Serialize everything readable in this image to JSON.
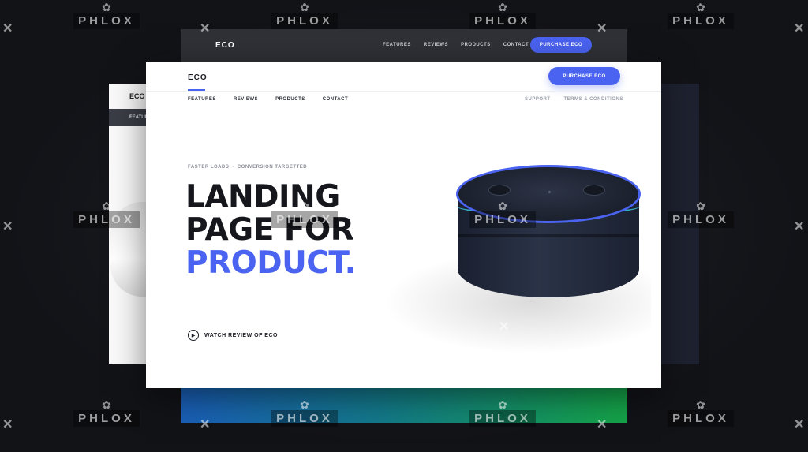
{
  "watermark": {
    "text": "PHLOX",
    "symbol": "✿",
    "cross": "✕"
  },
  "back_card": {
    "logo": "ECO",
    "nav": [
      "FEATURES",
      "REVIEWS",
      "PRODUCTS",
      "CONTACT"
    ],
    "button": "PURCHASE ECO"
  },
  "left_card": {
    "logo": "ECO",
    "nav_item": "FEATUR"
  },
  "header": {
    "logo": "ECO",
    "purchase_button": "PURCHASE ECO",
    "nav_left": [
      "FEATURES",
      "REVIEWS",
      "PRODUCTS",
      "CONTACT"
    ],
    "nav_right": [
      "SUPPORT",
      "TERMS & CONDITIONS"
    ]
  },
  "hero": {
    "eyebrow": [
      "FASTER LOADS",
      "·",
      "CONVERSION TARGETTED"
    ],
    "headline": [
      "LANDING",
      "PAGE FOR",
      "PRODUCT."
    ],
    "watch_label": "WATCH REVIEW OF ECO"
  },
  "colors": {
    "accent": "#4a63f0",
    "background": "#141519",
    "ring": "#38bfd8"
  }
}
